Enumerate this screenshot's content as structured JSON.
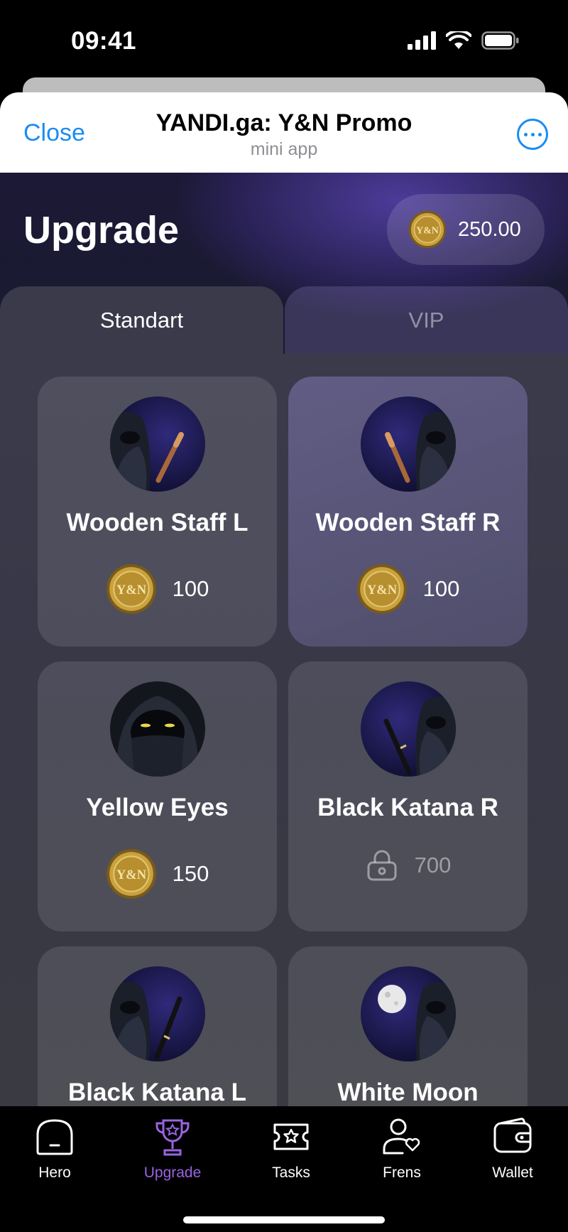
{
  "status_bar": {
    "time": "09:41"
  },
  "header": {
    "close_label": "Close",
    "title": "YANDI.ga: Y&N Promo",
    "subtitle": "mini app"
  },
  "page": {
    "title": "Upgrade",
    "balance": "250.00"
  },
  "tabs": [
    {
      "label": "Standart",
      "active": true
    },
    {
      "label": "VIP",
      "active": false
    }
  ],
  "cards": [
    {
      "name": "Wooden Staff L",
      "price": "100",
      "locked": false,
      "avatar": "ninja-staff-left"
    },
    {
      "name": "Wooden Staff R",
      "price": "100",
      "locked": false,
      "avatar": "ninja-staff-right"
    },
    {
      "name": "Yellow Eyes",
      "price": "150",
      "locked": false,
      "avatar": "ninja-yellow-eyes"
    },
    {
      "name": "Black Katana R",
      "price": "700",
      "locked": true,
      "avatar": "ninja-katana-right"
    },
    {
      "name": "Black Katana L",
      "price": "",
      "locked": false,
      "avatar": "ninja-katana-left"
    },
    {
      "name": "White Moon",
      "price": "",
      "locked": false,
      "avatar": "ninja-white-moon"
    }
  ],
  "coin_label": "Y&N",
  "nav": [
    {
      "label": "Hero",
      "icon": "hero-icon",
      "active": false
    },
    {
      "label": "Upgrade",
      "icon": "trophy-icon",
      "active": true
    },
    {
      "label": "Tasks",
      "icon": "ticket-star-icon",
      "active": false
    },
    {
      "label": "Frens",
      "icon": "friends-icon",
      "active": false
    },
    {
      "label": "Wallet",
      "icon": "wallet-icon",
      "active": false
    }
  ],
  "colors": {
    "accent": "#9a63e0",
    "link": "#1a8cf2",
    "coin": "#c9a23c"
  }
}
